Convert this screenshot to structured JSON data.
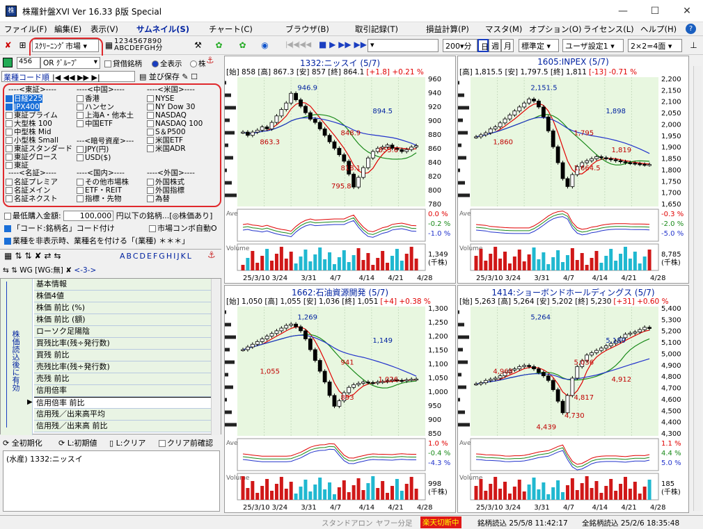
{
  "window": {
    "title": "株羅針盤XVI Ver 16.33 β版  Special",
    "min": "—",
    "max": "☐",
    "close": "✕"
  },
  "menu": [
    "ファイル(F)",
    "編集(E)",
    "表示(V)",
    "サムネイル(S)",
    "チャート(C)",
    "ブラウザ(B)",
    "取引記録(T)",
    "損益計算(P)",
    "マスタ(M)",
    "オプション(O)",
    "ライセンス(L)",
    "ヘルプ(H)"
  ],
  "toolbar": {
    "screening_market": "ｽｸﾘｰﾆﾝｸﾞ市場",
    "digits_top": "1234567890",
    "digits_bottom": "ABCDEFGH分",
    "period_select": "200",
    "unit": "分",
    "day": "日",
    "week": "週",
    "month": "月",
    "standard": "標準定",
    "user_setting": "ユーザ設定1",
    "grid": "2×2=4面",
    "pin": "⊥"
  },
  "left": {
    "count": "456",
    "or_group": "OR ｸﾞﾙｰﾌﾟ",
    "lending": "貸借銘柄",
    "show_all": "全表示",
    "show_other": "株",
    "sort_label": "業種コード順",
    "sort_save": "並び保存",
    "sections": {
      "tosho": "----<東証>----",
      "china": "----<中国>----",
      "usa": "----<米国>----",
      "crypto": "---<暗号資産>---",
      "meisho": "----<名証>----",
      "domestic": "----<国内>----",
      "foreign": "----<外国>----"
    },
    "col1": [
      "日経225",
      "JPX400",
      "東証プライム",
      "大型株 100",
      "中型株 Mid",
      "小型株 Small",
      "東証スタンダード",
      "東証グロース",
      "東証"
    ],
    "col1_checked": [
      true,
      true,
      false,
      false,
      false,
      false,
      false,
      false,
      false
    ],
    "col2": [
      "香港",
      "ハンセン",
      "上海A・他本土",
      "中国ETF"
    ],
    "col2b": [
      "JPY(円)",
      "USD($)"
    ],
    "col3": [
      "NYSE",
      "NY Dow 30",
      "NASDAQ",
      "NASDAQ 100",
      "S＆P500",
      "米国ETF",
      "米国ADR"
    ],
    "meisho_items": [
      "名証プレミア",
      "名証メイン",
      "名証ネクスト"
    ],
    "domestic_items": [
      "その他市場株",
      "ETF・REIT",
      "指標・先物"
    ],
    "foreign_items": [
      "外国株式",
      "外国指標",
      "為替"
    ],
    "min_buy_label": "最低購入金額:",
    "min_buy_value": "100,000",
    "min_buy_suffix": "円以下の銘柄...[◎株価あり]",
    "code_name": "「コード:銘柄名」コード付け",
    "market_combo": "市場コンボ自動O",
    "hide_sector": "業種を非表示時、業種名を付ける「(業種) ＊＊＊」",
    "alpha": "ABCDEFGHIJKL",
    "wg": "WG",
    "wg_none": "[WG:無]",
    "nav_pages": "<-3->",
    "vert_label": "株価読込後に有効",
    "grid_rows": [
      "基本情報",
      "株価4値",
      "株価 前比 (%)",
      "株価 前比 (額)",
      "ローソク足陽陰",
      "買残比率(残÷発行数)",
      "買残 前比",
      "売残比率(残÷発行数)",
      "売残 前比",
      "信用倍率",
      "信用倍率 前比",
      "信用残／出来高平均",
      "信用残／出来高 前比"
    ],
    "reset_all": "全初期化",
    "reset_l": "L:初期値",
    "clear_l": "L:クリア",
    "clear_before": "クリア前確認",
    "current_stock": "(水産) 1332:ニッスイ"
  },
  "status": {
    "standalone": "スタンドアロン",
    "yahoo": "ヤフー分足",
    "rakuten": "楽天切断中",
    "read1": "銘柄読込 25/5/8 11:42:17",
    "read2": "全銘柄読込 25/2/6 18:35:48"
  },
  "colors": {
    "candle_up": "#ffffff",
    "candle_down": "#000000",
    "ma_short": "#e00000",
    "ma_mid": "#1a8a1a",
    "ma_long": "#2233cc",
    "vol_up": "#d01818",
    "vol_down": "#20b8d0",
    "plot_bg": "#e8f7e0",
    "accent_red": "#e0282c"
  },
  "charts": [
    {
      "title": "1332:ニッスイ (5/7)",
      "info": "[始] 858 [高] 867.3 [安] 857 [終] 864.1",
      "change": "[+1.8] +0.21 %",
      "ylim": [
        770,
        970
      ],
      "yticks": [
        "960",
        "940",
        "920",
        "900",
        "880",
        "860",
        "840",
        "820",
        "800",
        "780"
      ],
      "labels": [
        "946.9",
        "894.5",
        "863.3",
        "855.6",
        "848.9",
        "818.1",
        "795.8"
      ],
      "ind": [
        "0.0 %",
        "-0.2 %",
        "-1.0 %"
      ],
      "vol": [
        "1,349",
        "(千株)"
      ],
      "dates": [
        "25/3/10",
        "3/24",
        "3/31",
        "4/7",
        "4/14",
        "4/21",
        "4/28"
      ],
      "closes": [
        885,
        880,
        885,
        888,
        893,
        890,
        900,
        910,
        920,
        930,
        945,
        935,
        925,
        915,
        905,
        900,
        890,
        880,
        870,
        860,
        850,
        840,
        820,
        800,
        815,
        830,
        845,
        855,
        860,
        862,
        865,
        860,
        858,
        855,
        858,
        862,
        864
      ]
    },
    {
      "title": "1605:INPEX (5/7)",
      "info": "[高] 1,815.5 [安] 1,797.5 [終] 1,811",
      "change": "[-13] -0.71 %",
      "ylim": [
        1600,
        2250
      ],
      "yticks": [
        "2,200",
        "2,150",
        "2,100",
        "2,050",
        "2,000",
        "1,950",
        "1,900",
        "1,850",
        "1,800",
        "1,750",
        "1,700",
        "1,650"
      ],
      "labels": [
        "2,151.5",
        "1,898",
        "1,860",
        "1,819",
        "1,795",
        "1,664.5"
      ],
      "ind": [
        "-0.3 %",
        "-2.0 %",
        "-5.0 %"
      ],
      "vol": [
        "8,785",
        "(千株)"
      ],
      "dates": [
        "25/3/10",
        "3/24",
        "3/31",
        "4/7",
        "4/14",
        "4/21",
        "4/28"
      ],
      "closes": [
        1950,
        1960,
        1970,
        1990,
        2000,
        2020,
        2040,
        2060,
        2080,
        2100,
        2120,
        2140,
        2130,
        2100,
        2050,
        1980,
        1900,
        1820,
        1740,
        1700,
        1760,
        1800,
        1820,
        1830,
        1840,
        1850,
        1845,
        1840,
        1835,
        1830,
        1825,
        1820,
        1818,
        1815,
        1812,
        1810,
        1811
      ]
    },
    {
      "title": "1662:石油資源開発 (5/7)",
      "info": "[始] 1,050 [高] 1,055 [安] 1,036 [終] 1,051",
      "change": "[+4] +0.38 %",
      "ylim": [
        840,
        1320
      ],
      "yticks": [
        "1,300",
        "1,250",
        "1,200",
        "1,150",
        "1,100",
        "1,050",
        "1,000",
        "950",
        "900",
        "850"
      ],
      "labels": [
        "1,269",
        "1,149",
        "1,055",
        "1,026",
        "941",
        "893"
      ],
      "ind": [
        "1.0 %",
        "-0.4 %",
        "-4.3 %"
      ],
      "vol": [
        "998",
        "(千株)"
      ],
      "dates": [
        "25/3/10",
        "3/24",
        "3/31",
        "4/7",
        "4/14",
        "4/21",
        "4/28"
      ],
      "closes": [
        1160,
        1170,
        1180,
        1190,
        1200,
        1210,
        1220,
        1230,
        1240,
        1250,
        1255,
        1245,
        1230,
        1200,
        1160,
        1120,
        1080,
        1040,
        990,
        950,
        970,
        1000,
        1020,
        1030,
        1035,
        1040,
        1038,
        1036,
        1040,
        1042,
        1045,
        1048,
        1046,
        1044,
        1048,
        1050,
        1051
      ]
    },
    {
      "title": "1414:ショーボンドホールディングス (5/7)",
      "info": "[始] 5,263 [高] 5,264 [安] 5,202 [終] 5,230",
      "change": "[+31] +0.60 %",
      "ylim": [
        4300,
        5420
      ],
      "yticks": [
        "5,400",
        "5,300",
        "5,200",
        "5,100",
        "5,000",
        "4,900",
        "4,800",
        "4,700",
        "4,600",
        "4,500",
        "4,400",
        "4,300"
      ],
      "labels": [
        "5,264",
        "5,189",
        "4,968",
        "4,912",
        "5,036",
        "4,817",
        "4,730",
        "4,439"
      ],
      "ind": [
        "1.1 %",
        "4.4 %",
        "5.0 %"
      ],
      "vol": [
        "185",
        "(千株)"
      ],
      "dates": [
        "25/3/10",
        "3/24",
        "3/31",
        "4/7",
        "4/14",
        "4/21",
        "4/28"
      ],
      "closes": [
        4750,
        4760,
        4780,
        4790,
        4800,
        4820,
        4850,
        4870,
        4880,
        4900,
        4910,
        4900,
        4880,
        4850,
        4820,
        4780,
        4700,
        4600,
        4500,
        4650,
        4800,
        4900,
        4950,
        5000,
        5020,
        5040,
        5060,
        5080,
        5100,
        5120,
        5150,
        5180,
        5190,
        5200,
        5220,
        5240,
        5230
      ]
    }
  ]
}
